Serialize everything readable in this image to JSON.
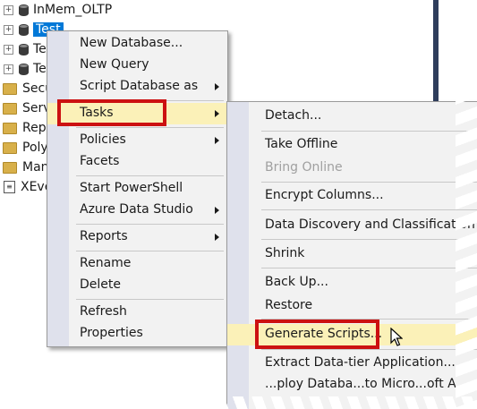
{
  "tree": {
    "items": [
      {
        "label": "InMem_OLTP",
        "kind": "database",
        "expander": "+"
      },
      {
        "label": "Test",
        "kind": "database",
        "expander": "+",
        "selected": true
      },
      {
        "label": "Te",
        "kind": "database",
        "expander": "+"
      },
      {
        "label": "Te",
        "kind": "database",
        "expander": "+"
      },
      {
        "label": "Secu",
        "kind": "folder"
      },
      {
        "label": "Serve",
        "kind": "folder"
      },
      {
        "label": "Repl",
        "kind": "folder"
      },
      {
        "label": "Poly",
        "kind": "folder"
      },
      {
        "label": "Man",
        "kind": "folder"
      },
      {
        "label": "XEve",
        "kind": "xevent"
      }
    ]
  },
  "context_menu": {
    "items": {
      "new_database": "New Database...",
      "new_query": "New Query",
      "script_database_as": "Script Database as",
      "tasks": "Tasks",
      "policies": "Policies",
      "facets": "Facets",
      "start_powershell": "Start PowerShell",
      "azure_data_studio": "Azure Data Studio",
      "reports": "Reports",
      "rename": "Rename",
      "delete": "Delete",
      "refresh": "Refresh",
      "properties": "Properties"
    }
  },
  "tasks_submenu": {
    "items": {
      "detach": "Detach...",
      "take_offline": "Take Offline",
      "bring_online": "Bring Online",
      "encrypt_columns": "Encrypt Columns...",
      "data_discovery": "Data Discovery and Classification",
      "shrink": "Shrink",
      "back_up": "Back Up...",
      "restore": "Restore",
      "generate_scripts": "Generate Scripts...",
      "extract_data_tier": "Extract Data-tier Application...",
      "deploy_partial": "...ploy Databa...to Micro...oft A..."
    }
  },
  "colors": {
    "menu_bg": "#f2f2f2",
    "gutter": "#dfe1ec",
    "highlight": "#fbf1b8",
    "callout_red": "#cc1111",
    "selection": "#0078d7"
  }
}
